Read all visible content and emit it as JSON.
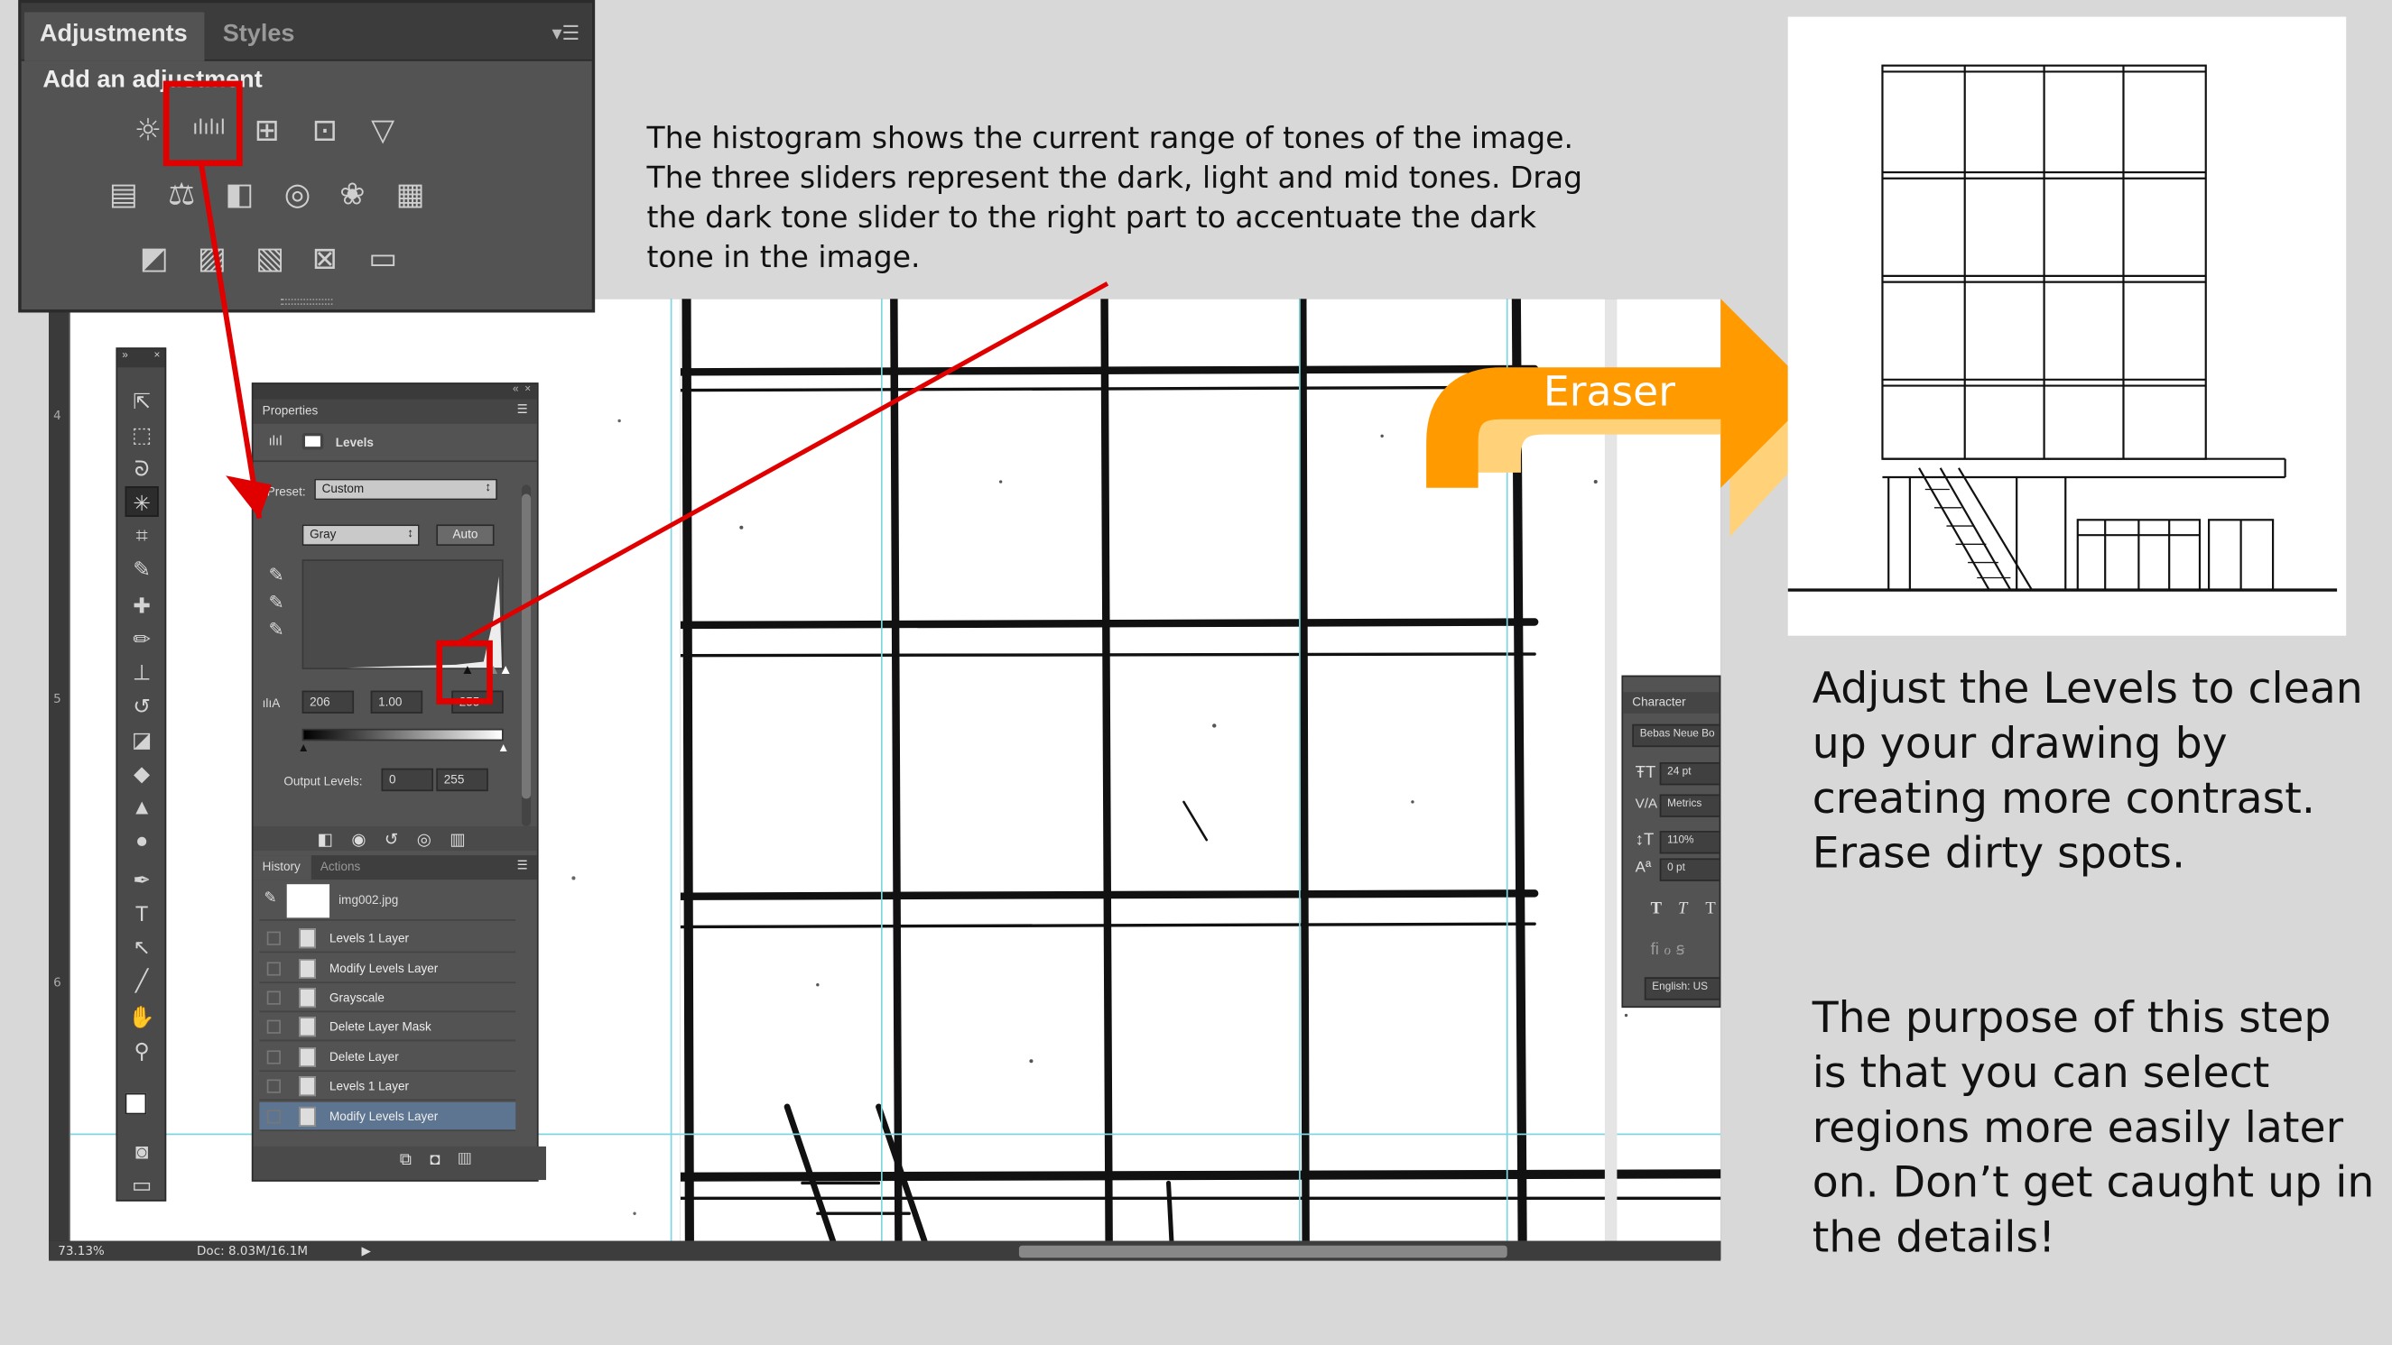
{
  "adjustments_panel": {
    "tab_active": "Adjustments",
    "tab_inactive": "Styles",
    "heading": "Add an adjustment",
    "row1_icons": [
      "brightness-icon",
      "levels-icon",
      "curves-icon",
      "exposure-icon",
      "vibrance-icon"
    ],
    "row2_icons": [
      "hue-saturation-icon",
      "color-balance-icon",
      "black-white-icon",
      "photo-filter-icon",
      "channel-mixer-icon",
      "color-lookup-icon"
    ],
    "row3_icons": [
      "invert-icon",
      "posterize-icon",
      "threshold-icon",
      "selective-color-icon",
      "gradient-map-icon"
    ]
  },
  "status_bar": {
    "zoom": "73.13%",
    "doc": "Doc: 8.03M/16.1M"
  },
  "ruler_labels": [
    "4",
    "5",
    "6"
  ],
  "properties_panel": {
    "title": "Properties",
    "adjustment_name": "Levels",
    "preset_label": "Preset:",
    "preset_value": "Custom",
    "channel_value": "Gray",
    "auto_label": "Auto",
    "input_black": "206",
    "input_mid": "1.00",
    "input_white": "255",
    "output_label": "Output Levels:",
    "output_black": "0",
    "output_white": "255"
  },
  "history_panel": {
    "tab_active": "History",
    "tab_inactive": "Actions",
    "snapshot": "img002.jpg",
    "items": [
      "Levels 1 Layer",
      "Modify Levels Layer",
      "Grayscale",
      "Delete Layer Mask",
      "Delete Layer",
      "Levels 1 Layer",
      "Modify Levels Layer"
    ],
    "selected_index": 6
  },
  "character_panel": {
    "title": "Character",
    "font": "Bebas Neue Bo",
    "size": "24 pt",
    "kerning": "Metrics",
    "scale": "110%",
    "baseline": "0 pt",
    "styles": [
      "T",
      "T",
      "T"
    ],
    "language": "English: US"
  },
  "annotation": {
    "histogram_note": "The histogram shows the current range of tones of the image. The three sliders represent the dark, light and mid tones. Drag the dark tone slider to the right part to accentuate the dark tone in the image.",
    "eraser_label": "Eraser",
    "side_text_1": "Adjust the Levels to clean up your drawing by creating more contrast. Erase dirty spots.",
    "side_text_2": "The purpose of this step is that you can select regions more easily later on. Don’t get caught up in the details!"
  },
  "colors": {
    "highlight": "#e00000",
    "arrow": "#ff9a00",
    "arrow_shadow": "#ffd27a",
    "guide": "#7ed6e0"
  }
}
